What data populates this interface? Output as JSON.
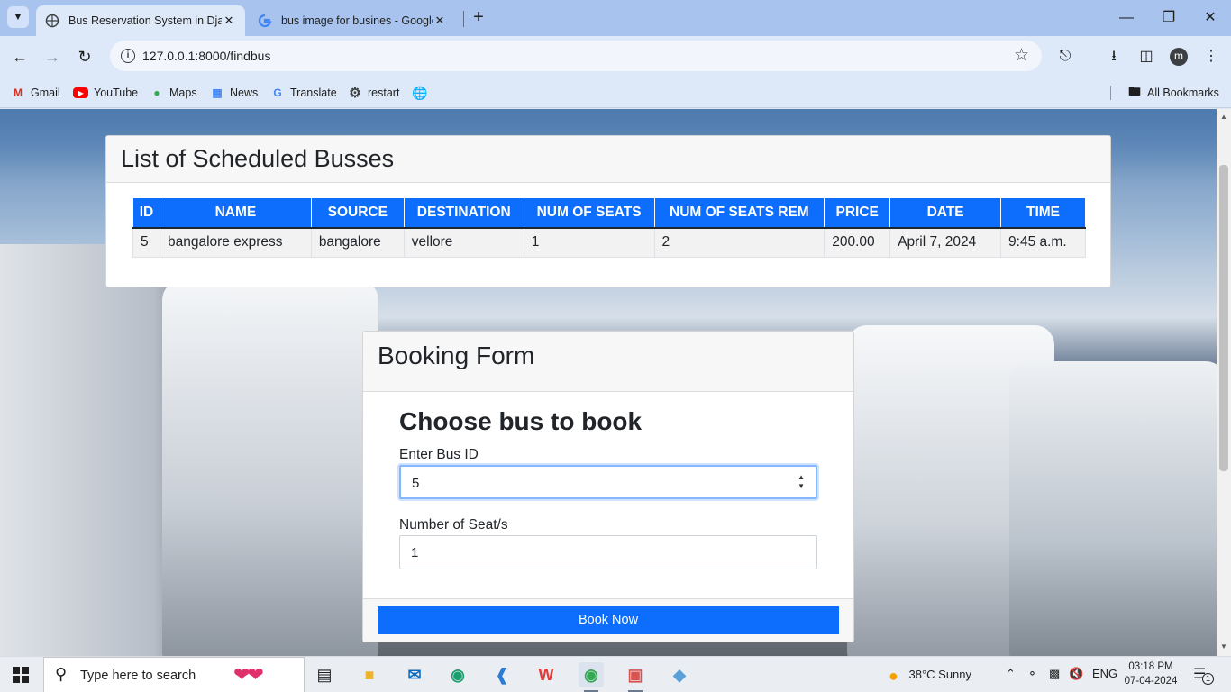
{
  "browser": {
    "tabs": [
      {
        "title": "Bus Reservation System in Djan",
        "active": true
      },
      {
        "title": "bus image for busines - Google",
        "active": false
      }
    ],
    "url": "127.0.0.1:8000/findbus",
    "bookmarks": [
      {
        "label": "Gmail",
        "icon": "gmail-icon"
      },
      {
        "label": "YouTube",
        "icon": "youtube-icon"
      },
      {
        "label": "Maps",
        "icon": "maps-icon"
      },
      {
        "label": "News",
        "icon": "news-icon"
      },
      {
        "label": "Translate",
        "icon": "translate-icon"
      },
      {
        "label": "restart",
        "icon": "gear-icon"
      }
    ],
    "all_bookmarks_label": "All Bookmarks",
    "profile_initial": "m"
  },
  "schedule": {
    "title": "List of Scheduled Busses",
    "columns": [
      "ID",
      "NAME",
      "SOURCE",
      "DESTINATION",
      "NUM OF SEATS",
      "NUM OF SEATS REM",
      "PRICE",
      "DATE",
      "TIME"
    ],
    "rows": [
      [
        "5",
        "bangalore express",
        "bangalore",
        "vellore",
        "1",
        "2",
        "200.00",
        "April 7, 2024",
        "9:45 a.m."
      ]
    ]
  },
  "booking": {
    "title": "Booking Form",
    "subtitle": "Choose bus to book",
    "bus_id_label": "Enter Bus ID",
    "bus_id_value": "5",
    "seats_label": "Number of Seat/s",
    "seats_value": "1",
    "submit_label": "Book Now"
  },
  "taskbar": {
    "search_placeholder": "Type here to search",
    "weather": "38°C  Sunny",
    "language": "ENG",
    "time": "03:18 PM",
    "date": "07-04-2024",
    "notification_count": "1"
  },
  "colors": {
    "primary": "#0d6efd",
    "tabstrip": "#a8c4ee",
    "toolbar": "#dde8f8"
  }
}
